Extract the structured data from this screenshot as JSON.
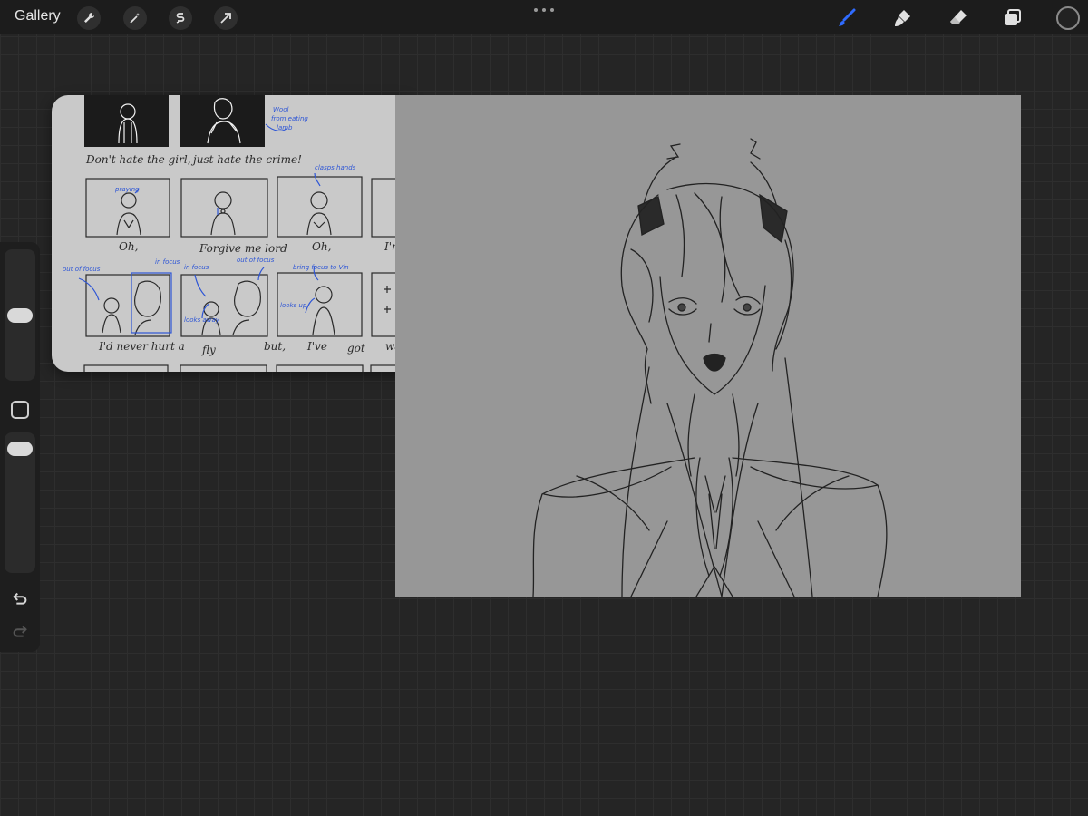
{
  "topbar": {
    "gallery_label": "Gallery",
    "left_tools": [
      {
        "icon": "wrench-icon",
        "name": "actions"
      },
      {
        "icon": "magic-wand-icon",
        "name": "adjustments"
      },
      {
        "icon": "selection-s-icon",
        "name": "selection"
      },
      {
        "icon": "transform-arrow-icon",
        "name": "transform"
      }
    ],
    "right_tools": [
      {
        "icon": "brush-icon",
        "name": "paint",
        "active": true
      },
      {
        "icon": "smudge-icon",
        "name": "smudge",
        "active": false
      },
      {
        "icon": "eraser-icon",
        "name": "erase",
        "active": false
      },
      {
        "icon": "layers-icon",
        "name": "layers",
        "active": false
      }
    ],
    "accent_color": "#2f6bff",
    "current_color": "#222222"
  },
  "sidebar": {
    "brush_size_icon": "slider",
    "opacity_icon": "slider",
    "modify_icon": "square-modify-icon",
    "undo_icon": "undo-icon",
    "redo_icon": "redo-icon"
  },
  "reference": {
    "lines": [
      {
        "text": "Don't hate the girl,"
      },
      {
        "text": "just hate the crime!"
      },
      {
        "text": "Oh,"
      },
      {
        "text": "Forgive me lord"
      },
      {
        "text": "Oh,"
      },
      {
        "text": "I'm a"
      },
      {
        "text": "I'd never hurt a"
      },
      {
        "text": "fly"
      },
      {
        "text": "but,"
      },
      {
        "text": "I've"
      },
      {
        "text": "got"
      },
      {
        "text": "walls"
      }
    ],
    "notes": [
      {
        "text": "Wool"
      },
      {
        "text": "from eating"
      },
      {
        "text": "lamb"
      },
      {
        "text": "clasps hands"
      },
      {
        "text": "praying"
      },
      {
        "text": "out of focus"
      },
      {
        "text": "in focus"
      },
      {
        "text": "in focus"
      },
      {
        "text": "out of focus"
      },
      {
        "text": "bring focus to Vin"
      },
      {
        "text": "looks away"
      },
      {
        "text": "looks up"
      }
    ]
  }
}
